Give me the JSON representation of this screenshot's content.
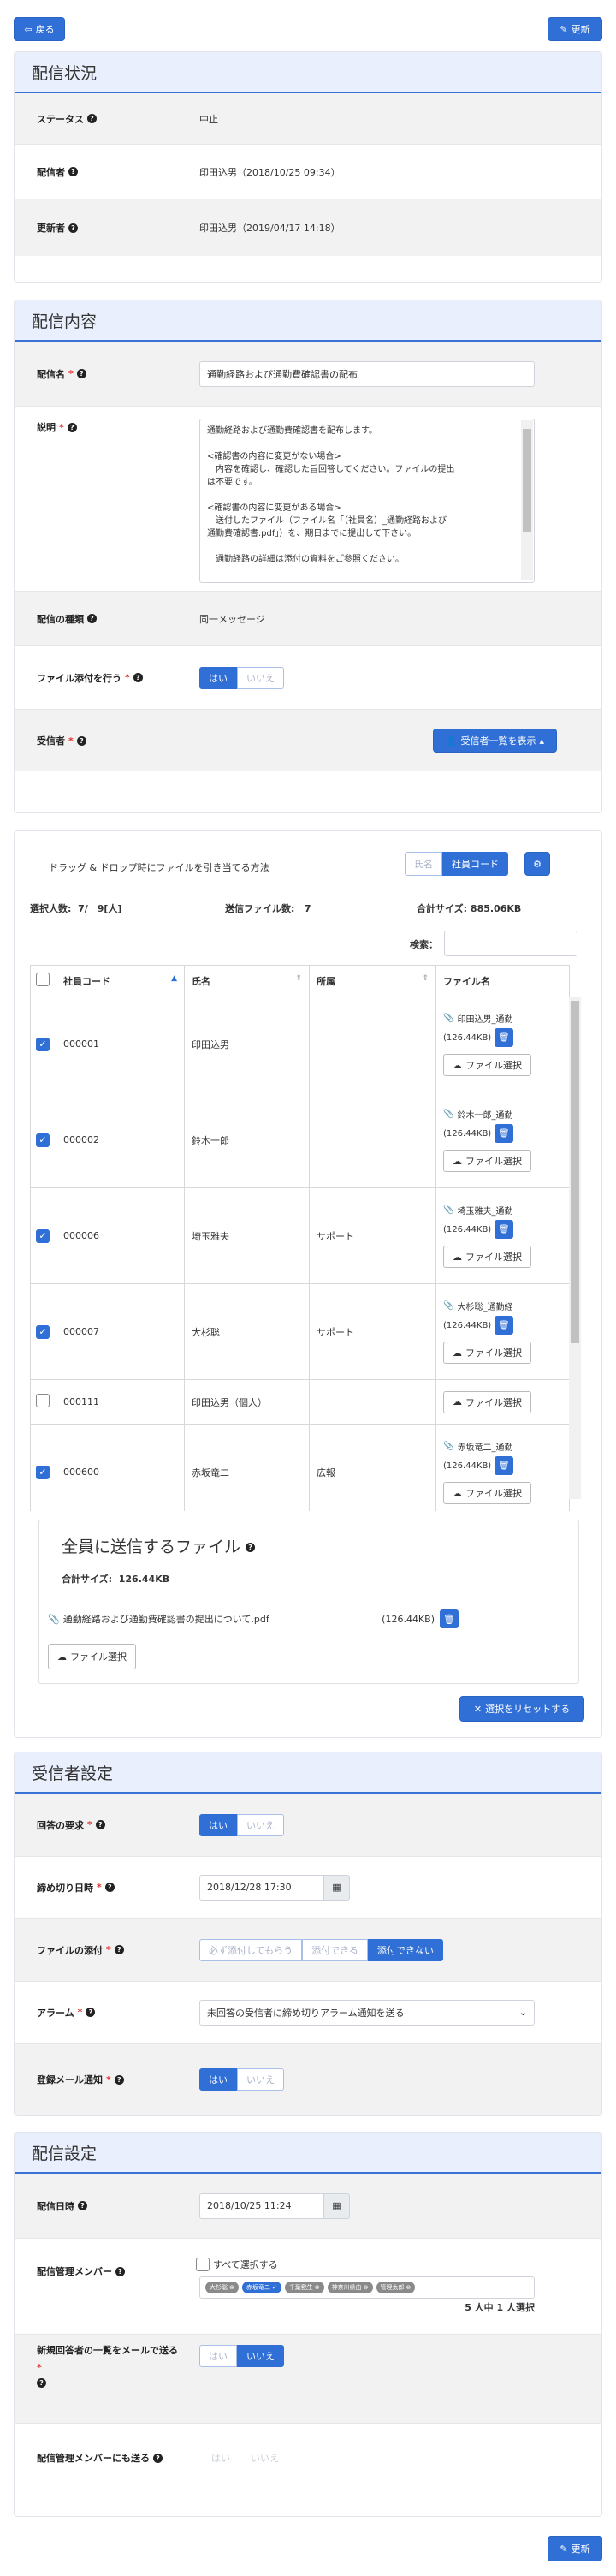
{
  "top": {
    "back_label": "戻る",
    "update_label": "更新"
  },
  "status": {
    "title": "配信状況",
    "rows": [
      {
        "label": "ステータス",
        "value": "中止"
      },
      {
        "label": "配信者",
        "value": "印田込男（2018/10/25 09:34）"
      },
      {
        "label": "更新者",
        "value": "印田込男（2019/04/17 14:18）"
      }
    ]
  },
  "content": {
    "title": "配信内容",
    "name_label": "配信名",
    "name_value": "通勤経路および通勤費確認書の配布",
    "desc_label": "説明",
    "desc_lines": [
      "通勤経路および通勤費確認書を配布します。",
      "",
      "<確認書の内容に変更がない場合>",
      "　内容を確認し、確認した旨回答してください。ファイルの提出",
      "は不要です。",
      "",
      "<確認書の内容に変更がある場合>",
      "　送付したファイル（ファイル名「（社員名）_通勤経路および",
      "通勤費確認書.pdf」）を、期日までに提出して下さい。",
      "",
      "　通勤経路の詳細は添付の資料をご参照ください。"
    ],
    "type_label": "配信の種類",
    "type_value": "同一メッセージ",
    "attach_label": "ファイル添付を行う",
    "attach_yes": "はい",
    "attach_no": "いいえ",
    "recipient_label": "受信者",
    "recipient_button": "受信者一覧を表示"
  },
  "recipients": {
    "drop_label": "ドラッグ & ドロップ時にファイルを引き当てる方法",
    "drop_opt_name": "氏名",
    "drop_opt_code": "社員コード",
    "selected_label": "選択人数:",
    "selected_value": "7/　9[人]",
    "files_label": "送信ファイル数:",
    "files_value": "7",
    "size_label": "合計サイズ:",
    "size_value": "885.06KB",
    "search_label": "検索：",
    "columns": [
      "社員コード",
      "氏名",
      "所属",
      "ファイル名"
    ],
    "rows": [
      {
        "checked": true,
        "code": "000001",
        "name": "印田込男",
        "dept": "",
        "file": "印田込男_通勤",
        "size": "(126.44KB)",
        "select": "ファイル選択"
      },
      {
        "checked": true,
        "code": "000002",
        "name": "鈴木一郎",
        "dept": "",
        "file": "鈴木一郎_通勤",
        "size": "(126.44KB)",
        "select": "ファイル選択"
      },
      {
        "checked": true,
        "code": "000006",
        "name": "埼玉雅夫",
        "dept": "サポート",
        "file": "埼玉雅夫_通勤",
        "size": "(126.44KB)",
        "select": "ファイル選択"
      },
      {
        "checked": true,
        "code": "000007",
        "name": "大杉聡",
        "dept": "サポート",
        "file": "大杉聡_通勤経",
        "size": "(126.44KB)",
        "select": "ファイル選択"
      },
      {
        "checked": false,
        "code": "000111",
        "name": "印田込男（個人）",
        "dept": "",
        "file": "",
        "size": "",
        "select": "ファイル選択"
      },
      {
        "checked": true,
        "code": "000600",
        "name": "赤坂竜二",
        "dept": "広報",
        "file": "赤坂竜二_通勤",
        "size": "(126.44KB)",
        "select": "ファイル選択"
      }
    ],
    "common_title": "全員に送信するファイル",
    "common_size_label": "合計サイズ:",
    "common_size_value": "126.44KB",
    "common_file_name": "通勤経路および通勤費確認書の提出について.pdf",
    "common_file_size": "(126.44KB)",
    "common_select": "ファイル選択",
    "reset_label": "選択をリセットする"
  },
  "recv_settings": {
    "title": "受信者設定",
    "answer_label": "回答の要求",
    "answer_yes": "はい",
    "answer_no": "いいえ",
    "deadline_label": "締め切り日時",
    "deadline_value": "2018/12/28 17:30",
    "file_label": "ファイルの添付",
    "file_opt1": "必ず添付してもらう",
    "file_opt2": "添付できる",
    "file_opt3": "添付できない",
    "alarm_label": "アラーム",
    "alarm_value": "未回答の受信者に締め切りアラーム通知を送る",
    "mail_label": "登録メール通知",
    "mail_yes": "はい",
    "mail_no": "いいえ"
  },
  "dist_settings": {
    "title": "配信設定",
    "date_label": "配信日時",
    "date_value": "2018/10/25 11:24",
    "members_label": "配信管理メンバー",
    "select_all": "すべて選択する",
    "tags": [
      {
        "label": "大杉聡",
        "on": false
      },
      {
        "label": "赤坂竜二",
        "on": true
      },
      {
        "label": "千葉我生",
        "on": false
      },
      {
        "label": "神奈川県由",
        "on": false
      },
      {
        "label": "管理太郎",
        "on": false
      }
    ],
    "count_text": "5 人中 1 人選択",
    "newmail_label": "新規回答者の一覧をメールで送る",
    "newmail_yes": "はい",
    "newmail_no": "いいえ",
    "sendmember_label": "配信管理メンバーにも送る",
    "sendmember_yes": "はい",
    "sendmember_no": "いいえ"
  },
  "bottom": {
    "update_label": "更新"
  }
}
